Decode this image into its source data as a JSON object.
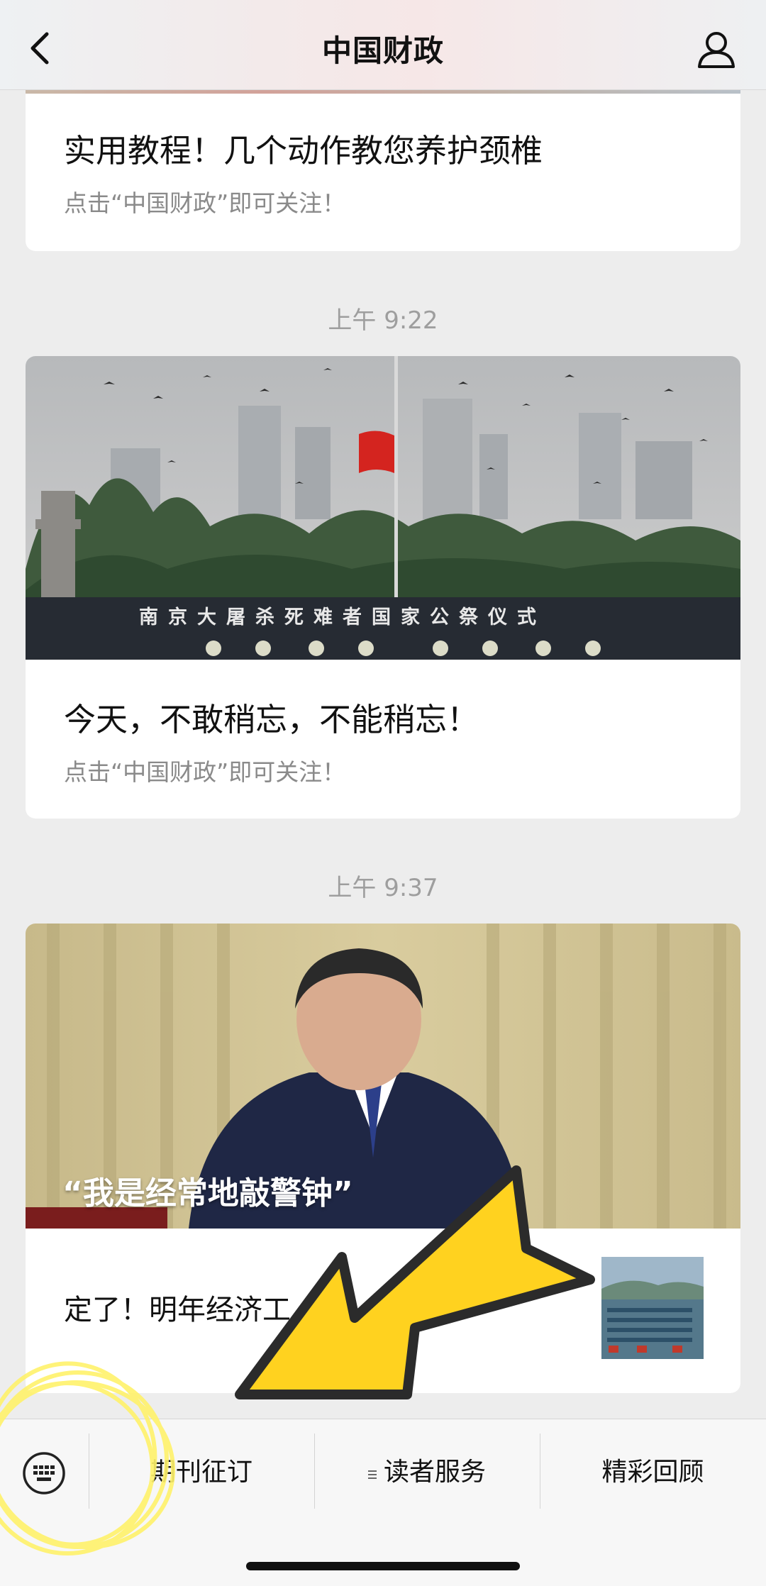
{
  "header": {
    "title": "中国财政",
    "back_icon": "chevron-left-icon",
    "profile_icon": "person-icon"
  },
  "messages": [
    {
      "title": "实用教程！几个动作教您养护颈椎",
      "subtitle": "点击“中国财政”即可关注！"
    },
    {
      "time": "上午 9:22",
      "image_caption": "南京大屠杀死难者国家公祭仪式",
      "title": "今天，不敢稍忘，不能稍忘！",
      "subtitle": "点击“中国财政”即可关注！"
    },
    {
      "time": "上午 9:37",
      "image_caption": "“我是经常地敲警钟”",
      "secondary_title": "定了！明年经济工"
    }
  ],
  "bottom_menu": {
    "keyboard_icon": "keyboard-icon",
    "items": [
      "期刊征订",
      "读者服务",
      "精彩回顾"
    ],
    "submenu_icon": "menu-lines-icon"
  },
  "annotations": {
    "arrow_color": "#FFD21F",
    "circle_color": "#FFF26B"
  },
  "colors": {
    "page_bg": "#EDEDED",
    "card_bg": "#FFFFFF",
    "subtitle": "#8A8A8A",
    "timestamp": "#9E9E9E"
  }
}
